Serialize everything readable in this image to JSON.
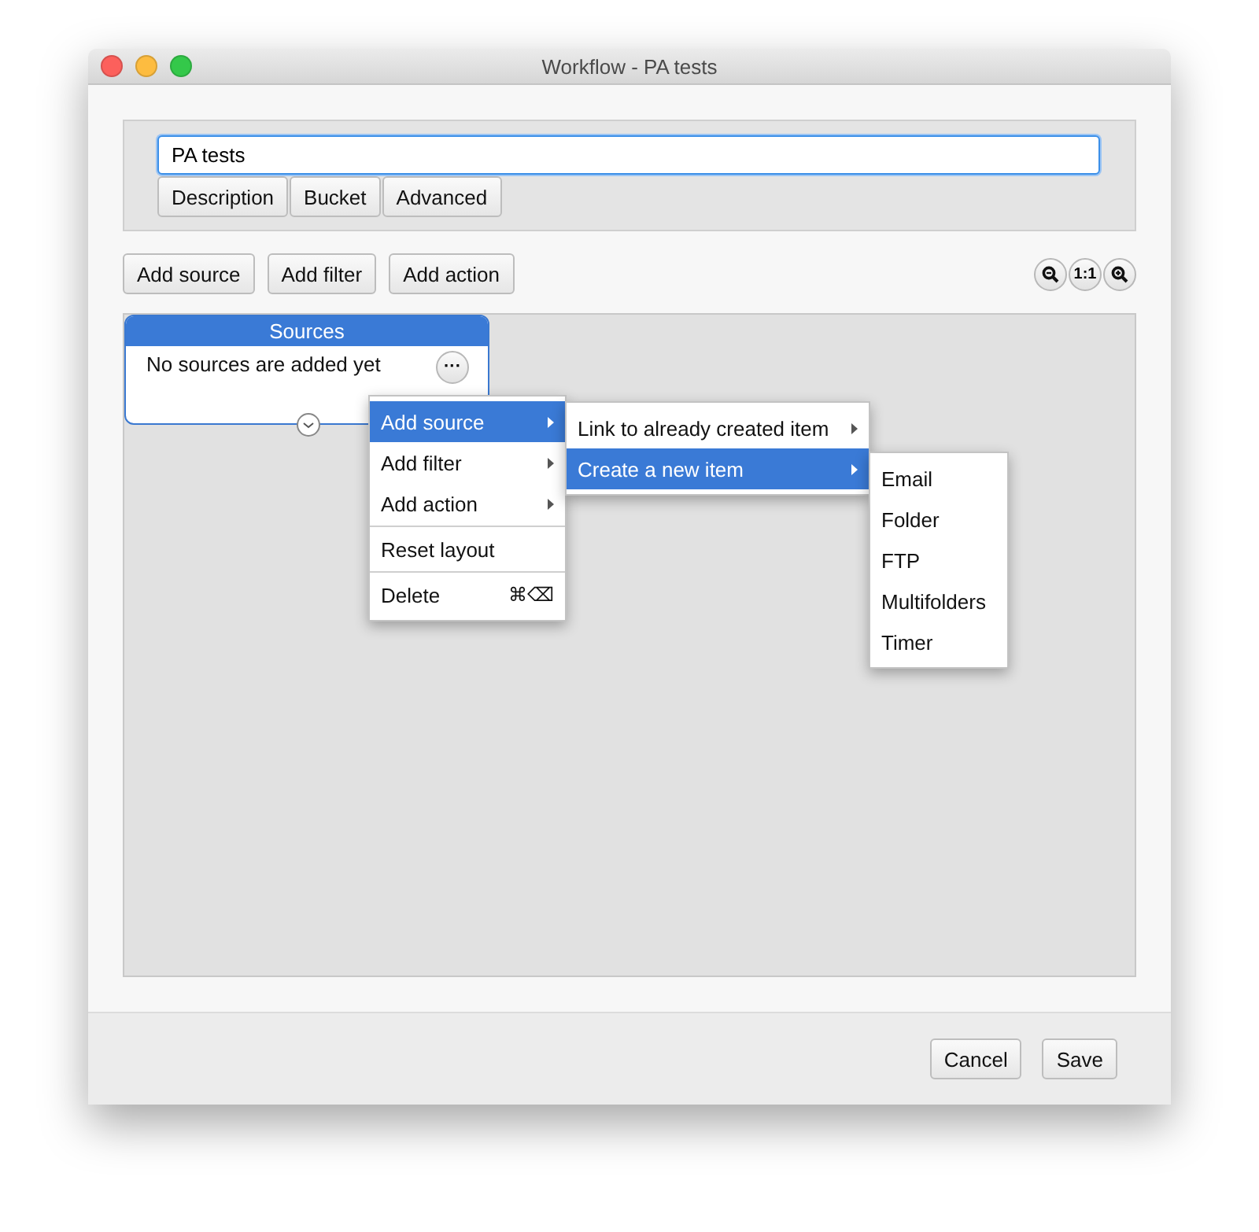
{
  "window": {
    "title": "Workflow - PA tests"
  },
  "name_field": {
    "value": "PA tests"
  },
  "tabs": [
    {
      "label": "Description",
      "selected": false
    },
    {
      "label": "Bucket",
      "selected": false
    },
    {
      "label": "Advanced",
      "selected": false
    }
  ],
  "toolbar": {
    "buttons": [
      "Add source",
      "Add filter",
      "Add action"
    ],
    "zoom_reset": "1:1"
  },
  "node": {
    "title": "Sources",
    "message": "No sources are added yet",
    "more": "···"
  },
  "menus": [
    {
      "items": [
        {
          "kind": "item",
          "label": "Add source",
          "selected": true,
          "submenu": true
        },
        {
          "kind": "item",
          "label": "Add filter",
          "selected": false,
          "submenu": true
        },
        {
          "kind": "item",
          "label": "Add action",
          "selected": false,
          "submenu": true
        },
        {
          "kind": "separator"
        },
        {
          "kind": "item",
          "label": "Reset layout",
          "selected": false,
          "submenu": false
        },
        {
          "kind": "separator"
        },
        {
          "kind": "item",
          "label": "Delete",
          "selected": false,
          "submenu": false,
          "shortcut": "⌘⌫"
        }
      ]
    },
    {
      "items": [
        {
          "kind": "item",
          "label": "Link to already created item",
          "selected": false,
          "submenu": true
        },
        {
          "kind": "item",
          "label": "Create a new item",
          "selected": true,
          "submenu": true
        }
      ]
    },
    {
      "items": [
        {
          "kind": "item",
          "label": "Email",
          "selected": false,
          "submenu": false
        },
        {
          "kind": "item",
          "label": "Folder",
          "selected": false,
          "submenu": false
        },
        {
          "kind": "item",
          "label": "FTP",
          "selected": false,
          "submenu": false
        },
        {
          "kind": "item",
          "label": "Multifolders",
          "selected": false,
          "submenu": false
        },
        {
          "kind": "item",
          "label": "Timer",
          "selected": false,
          "submenu": false
        }
      ]
    }
  ],
  "footer": {
    "buttons": [
      "Cancel",
      "Save"
    ]
  }
}
